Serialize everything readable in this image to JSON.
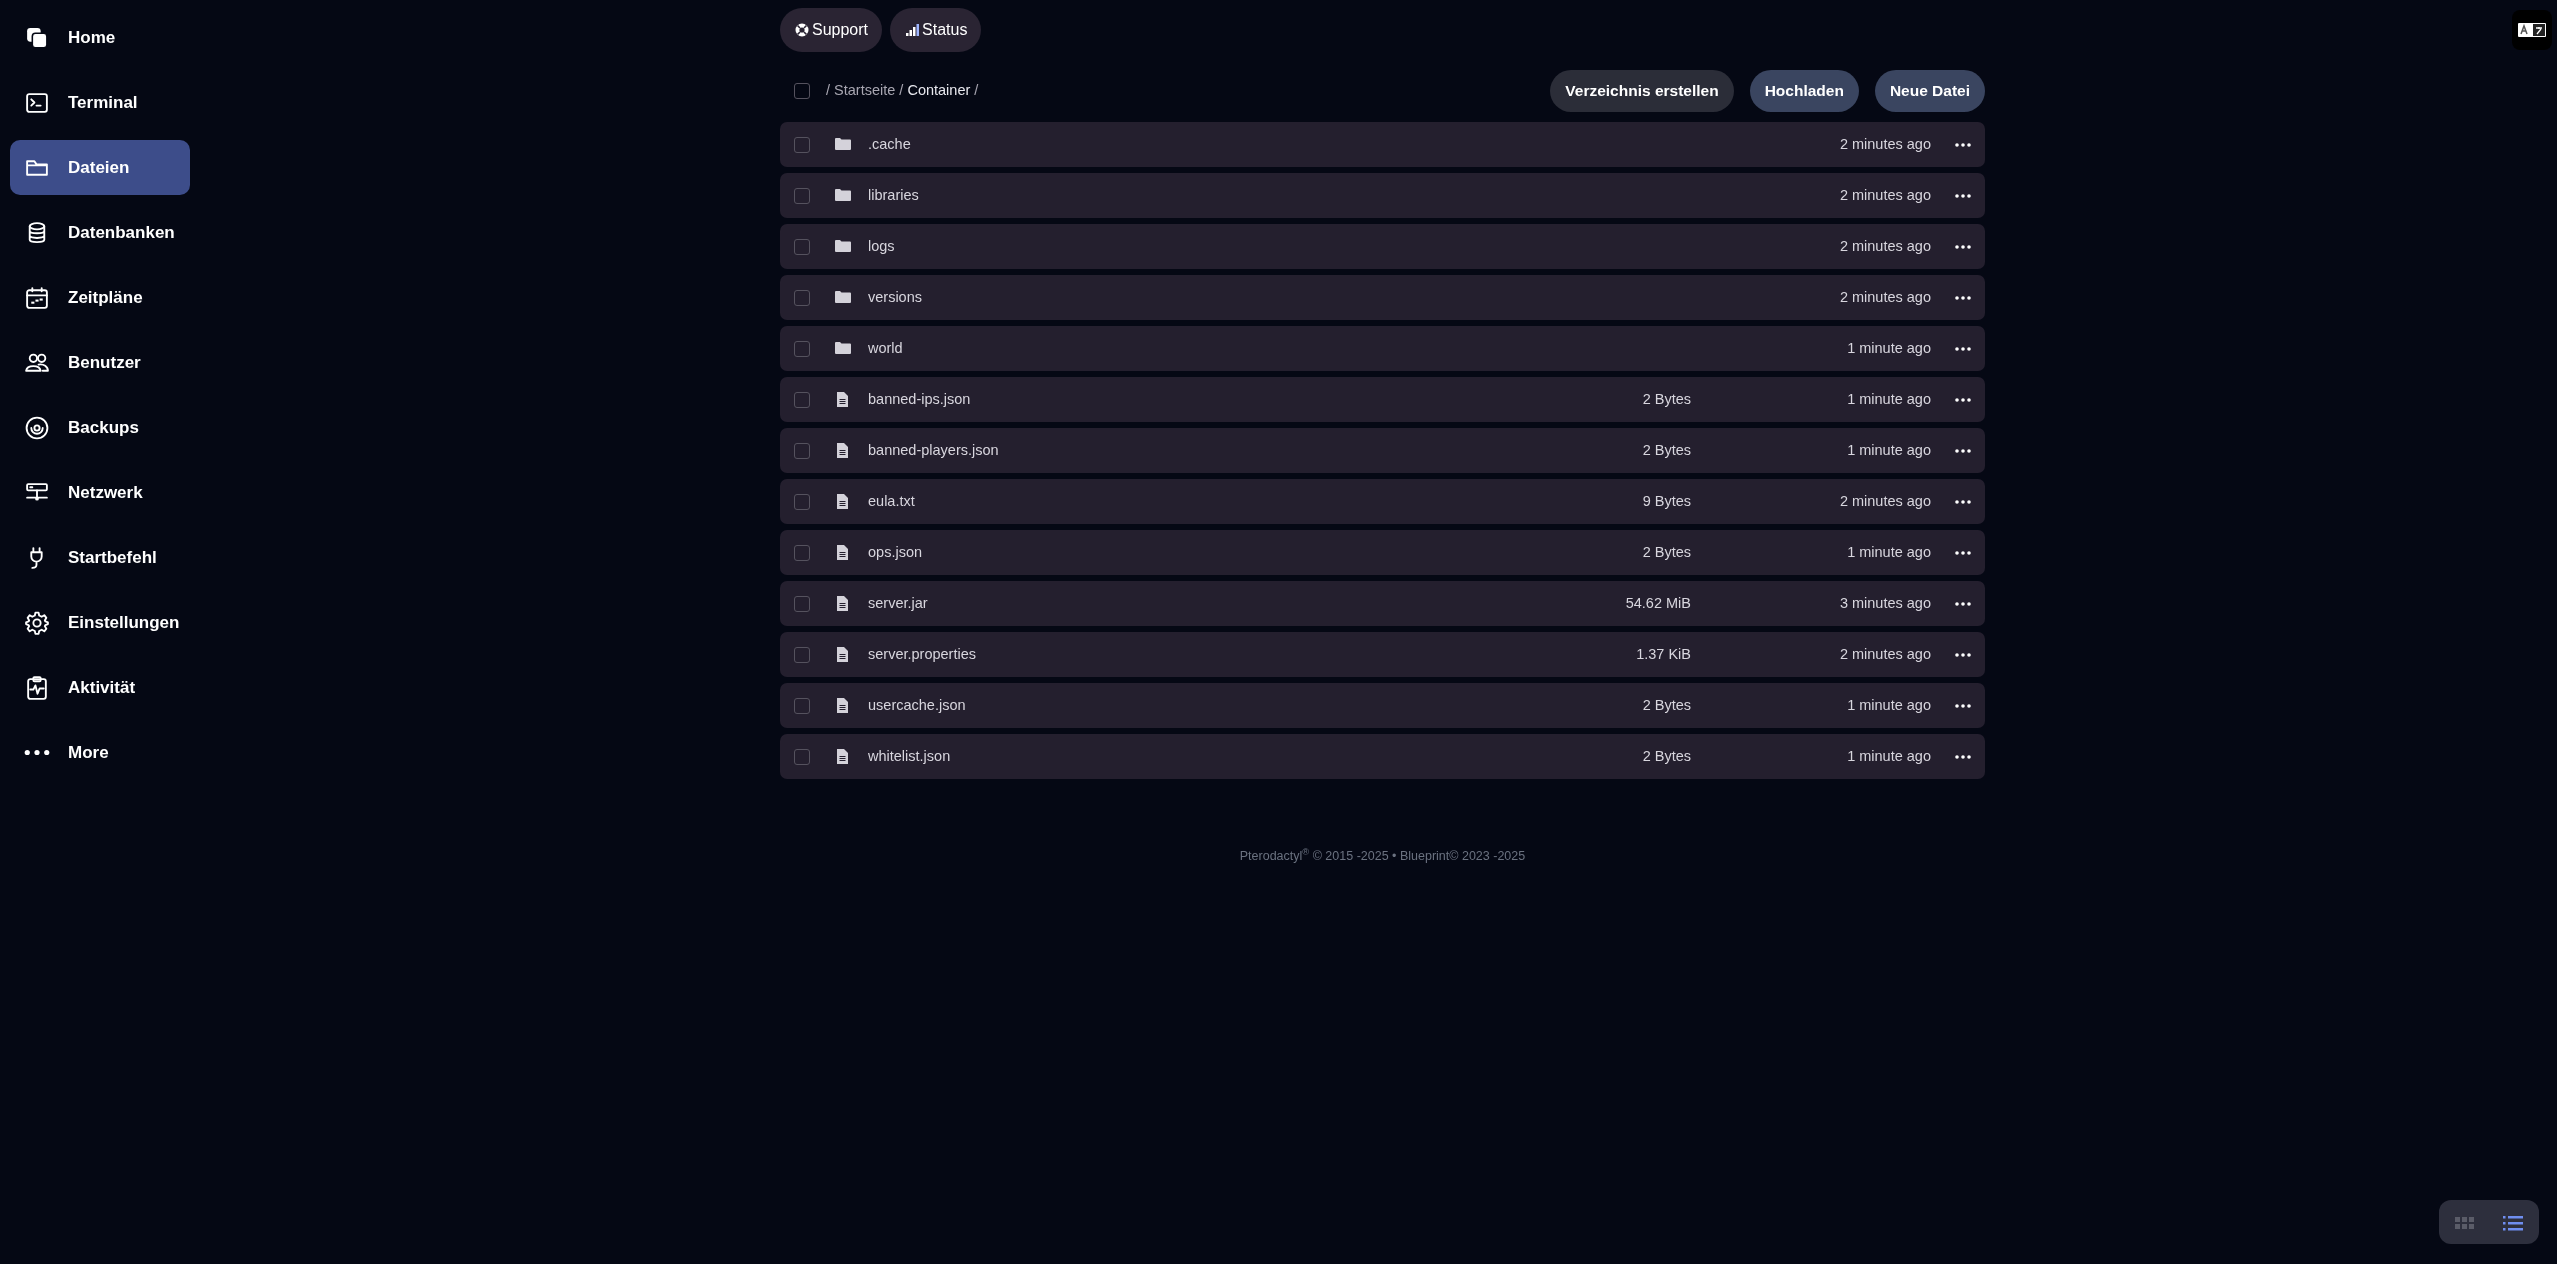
{
  "sidebar": {
    "items": [
      {
        "label": "Home",
        "selected": false
      },
      {
        "label": "Terminal",
        "selected": false
      },
      {
        "label": "Dateien",
        "selected": true
      },
      {
        "label": "Datenbanken",
        "selected": false
      },
      {
        "label": "Zeitpläne",
        "selected": false
      },
      {
        "label": "Benutzer",
        "selected": false
      },
      {
        "label": "Backups",
        "selected": false
      },
      {
        "label": "Netzwerk",
        "selected": false
      },
      {
        "label": "Startbefehl",
        "selected": false
      },
      {
        "label": "Einstellungen",
        "selected": false
      },
      {
        "label": "Aktivität",
        "selected": false
      },
      {
        "label": "More",
        "selected": false
      }
    ]
  },
  "top_links": [
    {
      "label": "Support"
    },
    {
      "label": "Status"
    }
  ],
  "toolbar": {
    "select_all_checked": false,
    "breadcrumb": [
      {
        "kind": "separator",
        "label": "/"
      },
      {
        "kind": "link",
        "label": "Startseite"
      },
      {
        "kind": "separator",
        "label": "/"
      },
      {
        "kind": "current",
        "label": "Container"
      },
      {
        "kind": "separator",
        "label": "/"
      }
    ],
    "buttons": [
      {
        "label": "Verzeichnis erstellen",
        "kind": "secondary"
      },
      {
        "label": "Hochladen",
        "kind": "primary"
      },
      {
        "label": "Neue Datei",
        "kind": "primary"
      }
    ]
  },
  "files": [
    {
      "kind": "folder",
      "name": ".cache",
      "modified": "2 minutes ago",
      "checked": false
    },
    {
      "kind": "folder",
      "name": "libraries",
      "modified": "2 minutes ago",
      "checked": false
    },
    {
      "kind": "folder",
      "name": "logs",
      "modified": "2 minutes ago",
      "checked": false
    },
    {
      "kind": "folder",
      "name": "versions",
      "modified": "2 minutes ago",
      "checked": false
    },
    {
      "kind": "folder",
      "name": "world",
      "modified": "1 minute ago",
      "checked": false
    },
    {
      "kind": "file",
      "name": "banned-ips.json",
      "size": "2 Bytes",
      "modified": "1 minute ago",
      "checked": false
    },
    {
      "kind": "file",
      "name": "banned-players.json",
      "size": "2 Bytes",
      "modified": "1 minute ago",
      "checked": false
    },
    {
      "kind": "file",
      "name": "eula.txt",
      "size": "9 Bytes",
      "modified": "2 minutes ago",
      "checked": false
    },
    {
      "kind": "file",
      "name": "ops.json",
      "size": "2 Bytes",
      "modified": "1 minute ago",
      "checked": false
    },
    {
      "kind": "file",
      "name": "server.jar",
      "size": "54.62 MiB",
      "modified": "3 minutes ago",
      "checked": false
    },
    {
      "kind": "file",
      "name": "server.properties",
      "size": "1.37 KiB",
      "modified": "2 minutes ago",
      "checked": false
    },
    {
      "kind": "file",
      "name": "usercache.json",
      "size": "2 Bytes",
      "modified": "1 minute ago",
      "checked": false
    },
    {
      "kind": "file",
      "name": "whitelist.json",
      "size": "2 Bytes",
      "modified": "1 minute ago",
      "checked": false
    }
  ],
  "footer": "Pterodactyl$^{®}$ © 2015 -2025  •  Blueprint© 2023 -2025",
  "view_toggle": [
    {
      "kind": "grid",
      "selected": false
    },
    {
      "kind": "list",
      "selected": true
    }
  ]
}
